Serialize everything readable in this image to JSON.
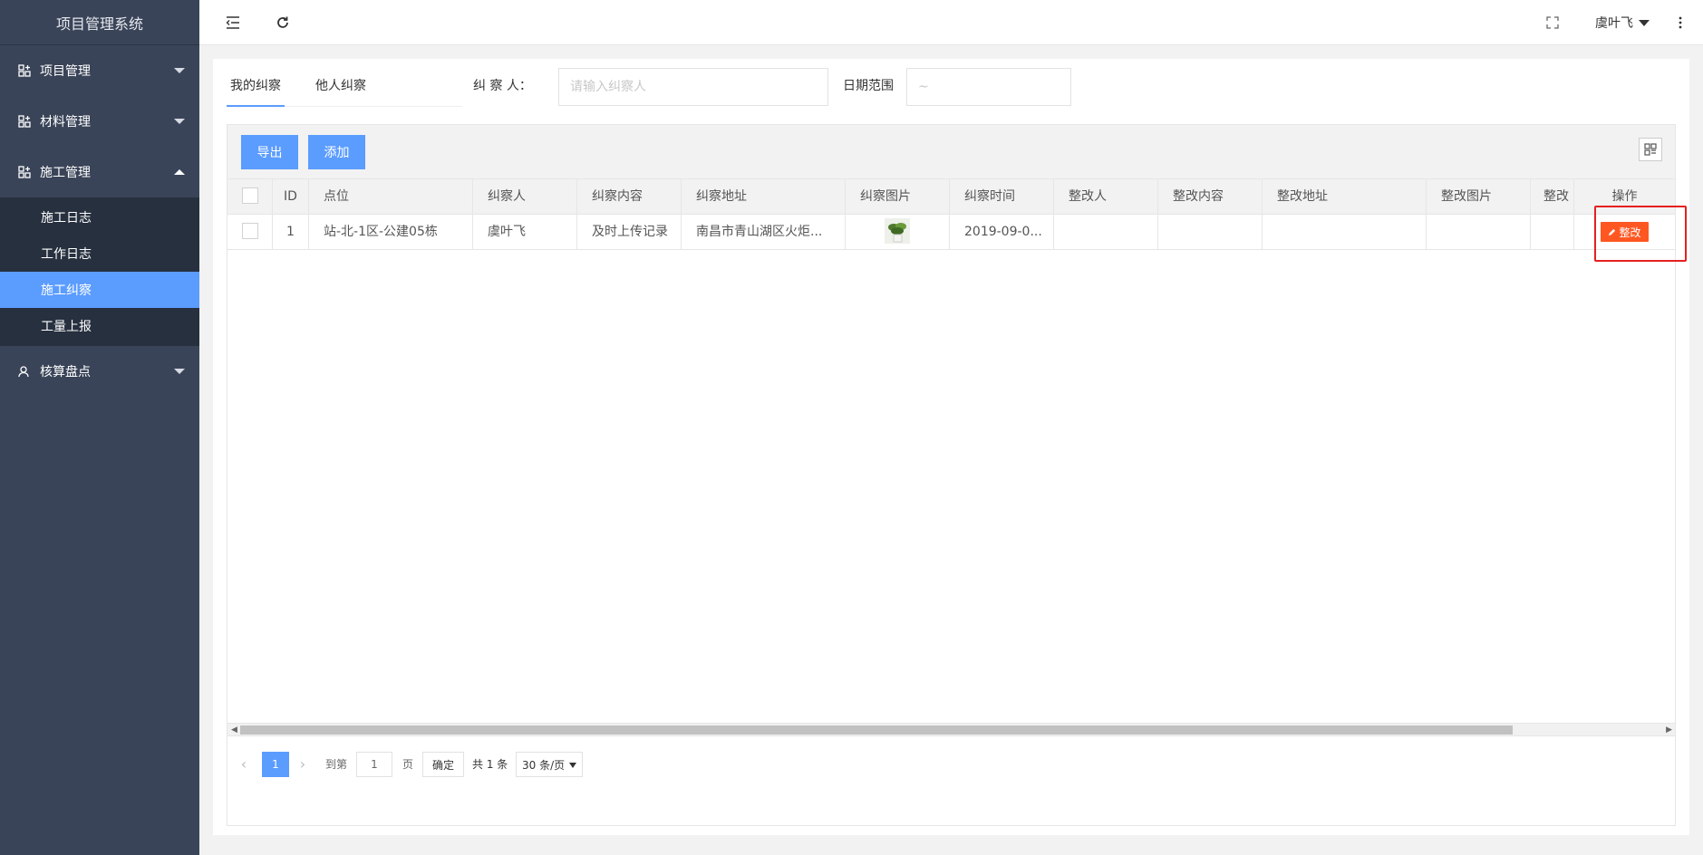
{
  "sidebar": {
    "title": "项目管理系统",
    "menus": [
      {
        "label": "项目管理"
      },
      {
        "label": "材料管理"
      },
      {
        "label": "施工管理"
      },
      {
        "label": "核算盘点"
      }
    ],
    "submenu": [
      {
        "label": "施工日志"
      },
      {
        "label": "工作日志"
      },
      {
        "label": "施工纠察"
      },
      {
        "label": "工量上报"
      }
    ]
  },
  "header": {
    "user": "虞叶飞"
  },
  "tabs": [
    {
      "label": "我的纠察"
    },
    {
      "label": "他人纠察"
    }
  ],
  "filters": {
    "inspector_label": "纠 察 人：",
    "inspector_placeholder": "请输入纠察人",
    "date_label": "日期范围",
    "date_value": "~"
  },
  "toolbar": {
    "export_label": "导出",
    "add_label": "添加"
  },
  "table": {
    "columns": [
      "ID",
      "点位",
      "纠察人",
      "纠察内容",
      "纠察地址",
      "纠察图片",
      "纠察时间",
      "整改人",
      "整改内容",
      "整改地址",
      "整改图片",
      "整改",
      "操作"
    ],
    "rows": [
      {
        "id": "1",
        "point": "站-北-1区-公建05栋",
        "inspector": "虞叶飞",
        "content": "及时上传记录",
        "address": "南昌市青山湖区火炬...",
        "time": "2019-09-0...",
        "action": "整改"
      }
    ]
  },
  "pager": {
    "current": "1",
    "goto_label": "到第",
    "goto_value": "1",
    "page_unit": "页",
    "confirm": "确定",
    "total": "共 1 条",
    "page_size": "30 条/页"
  }
}
